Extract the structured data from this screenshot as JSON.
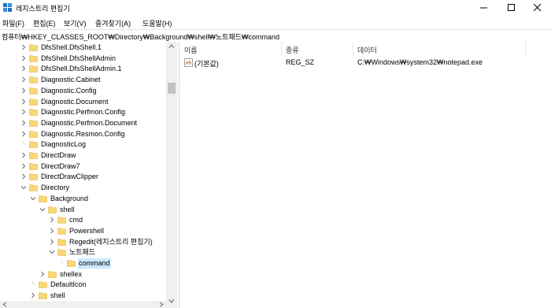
{
  "window": {
    "title": "레지스트리 편집기"
  },
  "menu": [
    {
      "label": "파일(F)"
    },
    {
      "label": "편집(E)"
    },
    {
      "label": "보기(V)"
    },
    {
      "label": "즐겨찾기(A)"
    },
    {
      "label": "도움말(H)"
    }
  ],
  "address": {
    "path": "컴퓨터₩HKEY_CLASSES_ROOT₩Directory₩Background₩shell₩노트패드₩command"
  },
  "tree": {
    "items": [
      {
        "label": "DfsShell.DfsShell.1",
        "expander": "right"
      },
      {
        "label": "DfsShell.DfsShellAdmin",
        "expander": "right"
      },
      {
        "label": "DfsShell.DfsShellAdmin.1",
        "expander": "right"
      },
      {
        "label": "Diagnostic.Cabinet",
        "expander": "right"
      },
      {
        "label": "Diagnostic.Config",
        "expander": "right"
      },
      {
        "label": "Diagnostic.Document",
        "expander": "right"
      },
      {
        "label": "Diagnostic.Perfmon.Config",
        "expander": "right"
      },
      {
        "label": "Diagnostic.Perfmon.Document",
        "expander": "right"
      },
      {
        "label": "Diagnostic.Resmon.Config",
        "expander": "right"
      },
      {
        "label": "DiagnosticLog",
        "expander": "none"
      },
      {
        "label": "DirectDraw",
        "expander": "right"
      },
      {
        "label": "DirectDraw7",
        "expander": "right"
      },
      {
        "label": "DirectDrawClipper",
        "expander": "right"
      },
      {
        "label": "Directory",
        "expander": "down"
      },
      {
        "label": "Background",
        "expander": "down"
      },
      {
        "label": "shell",
        "expander": "down"
      },
      {
        "label": "cmd",
        "expander": "right"
      },
      {
        "label": "Powershell",
        "expander": "right"
      },
      {
        "label": "Regedit(레지스트리 편집기)",
        "expander": "right"
      },
      {
        "label": "노트패드",
        "expander": "down"
      },
      {
        "label": "command",
        "expander": "none",
        "selected": true
      },
      {
        "label": "shellex",
        "expander": "right"
      },
      {
        "label": "DefaultIcon",
        "expander": "none"
      },
      {
        "label": "shell",
        "expander": "right"
      }
    ]
  },
  "list": {
    "columns": [
      {
        "label": "이름"
      },
      {
        "label": "종류"
      },
      {
        "label": "데이터"
      }
    ],
    "rows": [
      {
        "name": "(기본값)",
        "type": "REG_SZ",
        "data": "C:₩Windows₩system32₩notepad.exe"
      }
    ]
  },
  "colors": {
    "selection": "#cce8ff",
    "folder": "#f8d775",
    "folder_dark": "#e0b84a",
    "ab_icon": "#c0392b"
  }
}
